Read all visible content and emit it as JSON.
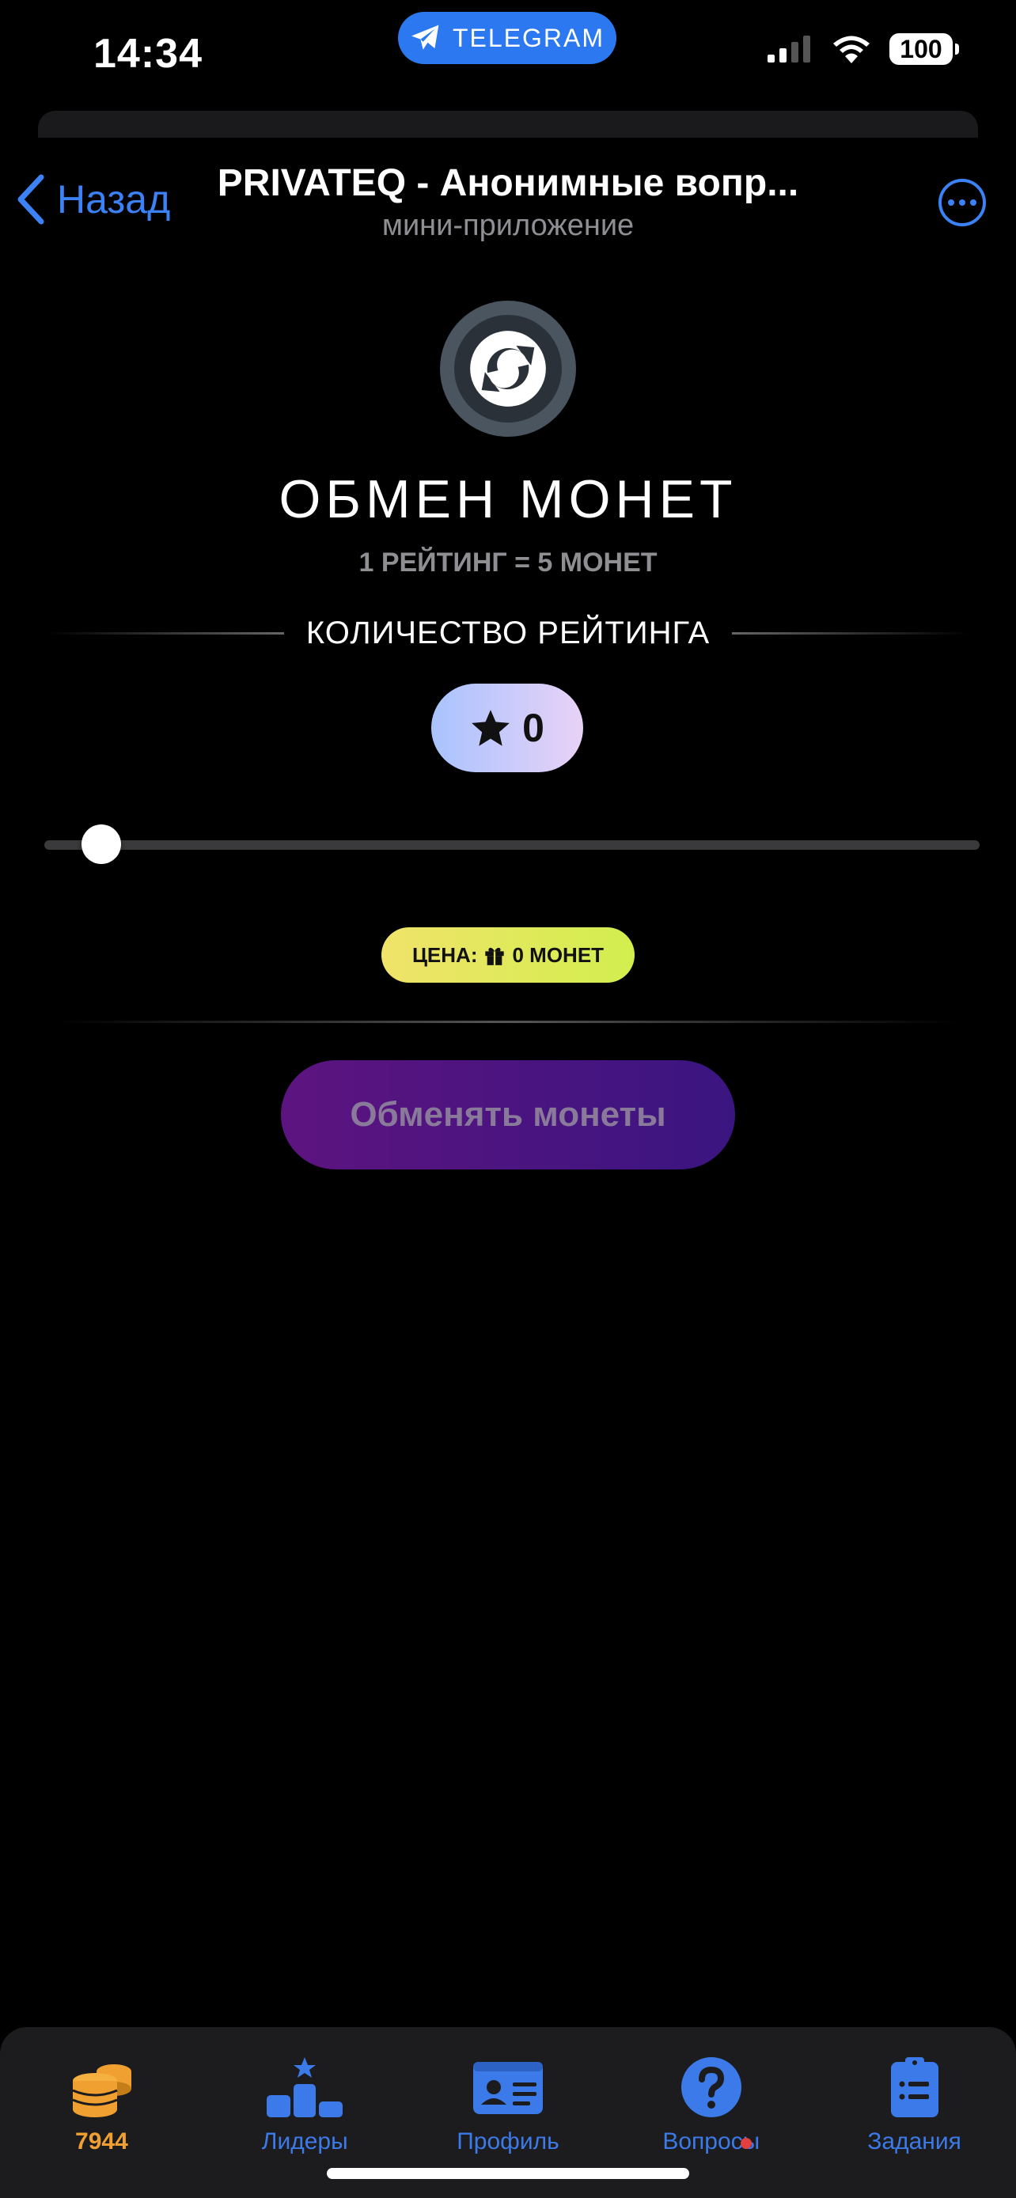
{
  "status_bar": {
    "time": "14:34",
    "app_pill": "TELEGRAM",
    "battery": "100"
  },
  "nav": {
    "back_label": "Назад",
    "title": "PRIVATEQ - Анонимные вопр...",
    "subtitle": "мини-приложение"
  },
  "exchange": {
    "title": "ОБМЕН МОНЕТ",
    "rate": "1 РЕЙТИНГ = 5 МОНЕТ",
    "amount_label": "КОЛИЧЕСТВО РЕЙТИНГА",
    "rating_value": "0",
    "slider_fraction": 0,
    "price_prefix": "ЦЕНА:",
    "price_value": "0 МОНЕТ",
    "button_label": "Обменять монеты"
  },
  "tabs": [
    {
      "label": "7944",
      "icon": "coins-icon"
    },
    {
      "label": "Лидеры",
      "icon": "podium-icon"
    },
    {
      "label": "Профиль",
      "icon": "id-card-icon"
    },
    {
      "label": "Вопросы",
      "icon": "question-icon"
    },
    {
      "label": "Задания",
      "icon": "clipboard-icon"
    }
  ],
  "colors": {
    "accent": "#3b82f6",
    "coins": "#f0a030",
    "button_gradient": [
      "#5d1480",
      "#3a1580"
    ]
  }
}
